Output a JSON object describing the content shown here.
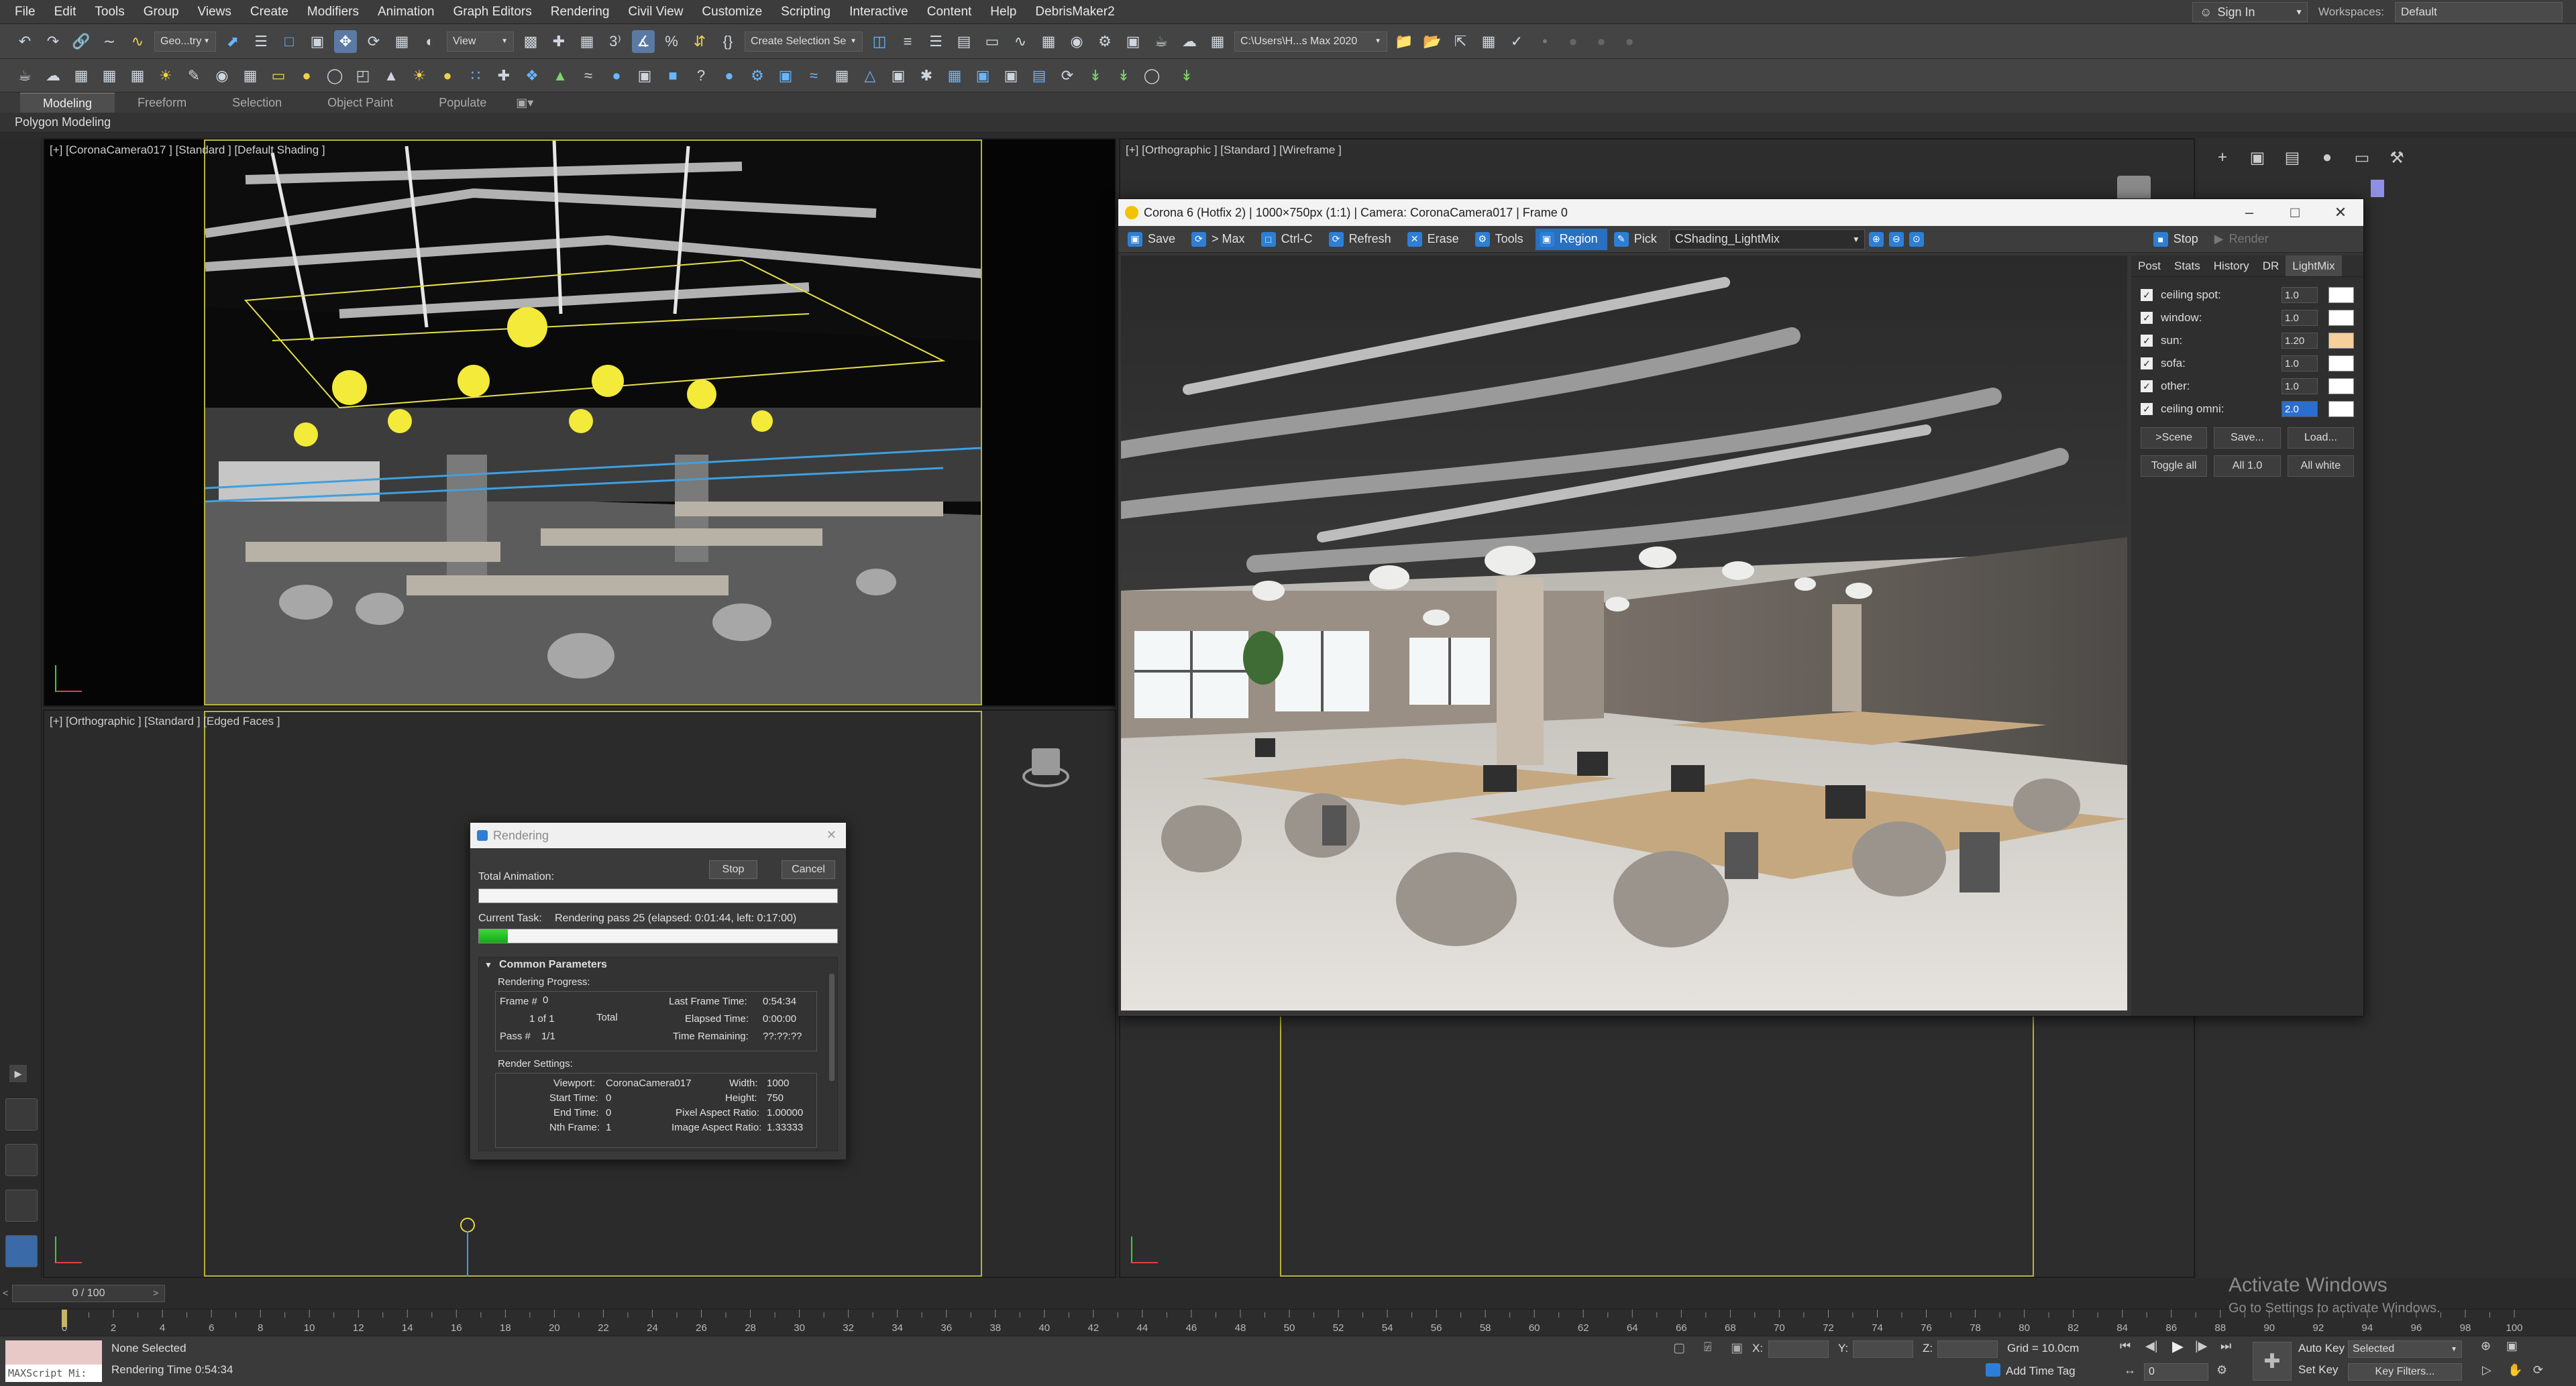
{
  "menu": [
    "File",
    "Edit",
    "Tools",
    "Group",
    "Views",
    "Create",
    "Modifiers",
    "Animation",
    "Graph Editors",
    "Rendering",
    "Civil View",
    "Customize",
    "Scripting",
    "Interactive",
    "Content",
    "Help",
    "DebrisMaker2"
  ],
  "account": {
    "sign_in": "Sign In",
    "workspaces_label": "Workspaces:",
    "workspace": "Default"
  },
  "toolbar": {
    "selection_filter": "Geo...try",
    "ref_coord": "View",
    "selection_set": "Create Selection Se",
    "project_path": "C:\\Users\\H...s Max 2020"
  },
  "ribbon": {
    "tabs": [
      "Modeling",
      "Freeform",
      "Selection",
      "Object Paint",
      "Populate"
    ],
    "active": "Modeling",
    "sub_label": "Polygon Modeling"
  },
  "viewports": {
    "top_left": "[+] [CoronaCamera017 ] [Standard ] [Default Shading ]",
    "top_right": "[+] [Orthographic ] [Standard ] [Wireframe ]",
    "bottom_left": "[+] [Orthographic ] [Standard ] [Edged Faces ]"
  },
  "vfb": {
    "title": "Corona 6 (Hotfix 2) | 1000×750px (1:1) | Camera: CoronaCamera017 | Frame 0",
    "buttons": [
      "Save",
      "> Max",
      "Ctrl-C",
      "Refresh",
      "Erase",
      "Tools",
      "Region",
      "Pick"
    ],
    "active_button": "Region",
    "render_element": "CShading_LightMix",
    "stop": "Stop",
    "render": "Render",
    "tabs": [
      "Post",
      "Stats",
      "History",
      "DR",
      "LightMix"
    ],
    "active_tab": "LightMix",
    "lightmix": [
      {
        "name": "ceiling spot:",
        "value": "1.0",
        "color": "#ffffff"
      },
      {
        "name": "window:",
        "value": "1.0",
        "color": "#ffffff"
      },
      {
        "name": "sun:",
        "value": "1.20",
        "color": "#f6cf9a"
      },
      {
        "name": "sofa:",
        "value": "1.0",
        "color": "#ffffff"
      },
      {
        "name": "other:",
        "value": "1.0",
        "color": "#ffffff"
      },
      {
        "name": "ceiling omni:",
        "value": "2.0",
        "color": "#ffffff"
      }
    ],
    "buttons_row1": [
      ">Scene",
      "Save...",
      "Load..."
    ],
    "buttons_row2": [
      "Toggle all",
      "All 1.0",
      "All white"
    ]
  },
  "render_dialog": {
    "title": "Rendering",
    "stop": "Stop",
    "cancel": "Cancel",
    "total_animation": "Total Animation:",
    "current_task_label": "Current Task:",
    "current_task": "Rendering pass 25 (elapsed: 0:01:44, left: 0:17:00)",
    "task_progress": 0.08,
    "section": "Common Parameters",
    "rendering_progress": "Rendering Progress:",
    "frame_label": "Frame #",
    "frame": "0",
    "of": "1 of 1",
    "total": "Total",
    "pass_label": "Pass #",
    "pass": "1/1",
    "last_frame_time": "Last Frame Time:",
    "last_frame_time_val": "0:54:34",
    "elapsed_time": "Elapsed Time:",
    "elapsed_time_val": "0:00:00",
    "time_remaining": "Time Remaining:",
    "time_remaining_val": "??:??:??",
    "render_settings": "Render Settings:",
    "viewport_label": "Viewport:",
    "viewport": "CoronaCamera017",
    "width_label": "Width:",
    "width": "1000",
    "start_time_label": "Start Time:",
    "start_time": "0",
    "height_label": "Height:",
    "height": "750",
    "end_time_label": "End Time:",
    "end_time": "0",
    "pixel_aspect_label": "Pixel Aspect Ratio:",
    "pixel_aspect": "1.00000",
    "nth_frame_label": "Nth Frame:",
    "nth_frame": "1",
    "image_aspect_label": "Image Aspect Ratio:",
    "image_aspect": "1.33333"
  },
  "timeline": {
    "slider": "0 / 100",
    "ticks": [
      "0",
      "2",
      "4",
      "6",
      "8",
      "10",
      "12",
      "14",
      "16",
      "18",
      "20",
      "22",
      "24",
      "26",
      "28",
      "30",
      "32",
      "34",
      "36",
      "38",
      "40",
      "42",
      "44",
      "46",
      "48",
      "50",
      "52",
      "54",
      "56",
      "58",
      "60",
      "62",
      "64",
      "66",
      "68",
      "70",
      "72",
      "74",
      "76",
      "78",
      "80",
      "82",
      "84",
      "86",
      "88",
      "90",
      "92",
      "94",
      "96",
      "98",
      "100"
    ]
  },
  "status": {
    "maxscript": "MAXScript Mi:",
    "selection": "None Selected",
    "render_time": "Rendering Time  0:54:34",
    "x": "X:",
    "y": "Y:",
    "z": "Z:",
    "grid": "Grid = 10.0cm",
    "add_time_tag": "Add Time Tag",
    "auto_key": "Auto Key",
    "set_key": "Set Key",
    "selected": "Selected",
    "key_filters": "Key Filters...",
    "frame": "0"
  },
  "watermark": {
    "line1": "Activate Windows",
    "line2": "Go to Settings to activate Windows."
  }
}
